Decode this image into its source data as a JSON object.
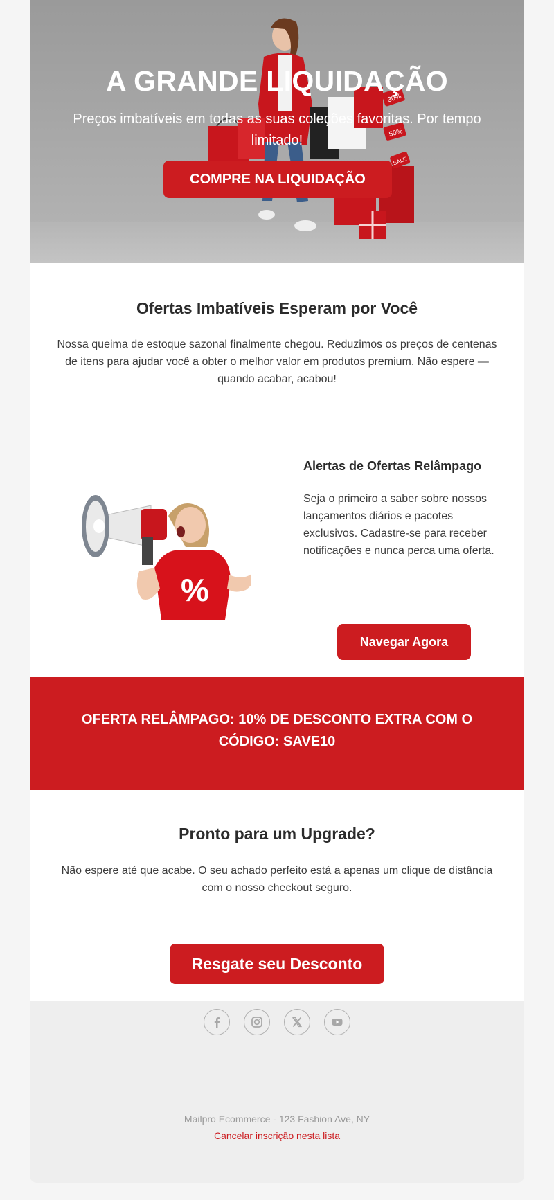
{
  "hero": {
    "title": "A GRANDE LIQUIDAÇÃO",
    "subtitle": "Preços imbatíveis em todas as suas coleções favoritas. Por tempo limitado!",
    "cta_label": "COMPRE NA LIQUIDAÇÃO",
    "tag_labels": [
      "30%",
      "50%",
      "SALE"
    ]
  },
  "intro": {
    "title": "Ofertas Imbatíveis Esperam por Você",
    "text": "Nossa queima de estoque sazonal finalmente chegou. Reduzimos os preços de centenas de itens para ajudar você a obter o melhor valor em produtos premium. Não espere — quando acabar, acabou!"
  },
  "alerts": {
    "title": "Alertas de Ofertas Relâmpago",
    "text": "Seja o primeiro a saber sobre nossos lançamentos diários e pacotes exclusivos. Cadastre-se para receber notificações e nunca perca uma oferta.",
    "cta_label": "Navegar Agora",
    "shirt_symbol": "%"
  },
  "promo": {
    "text": "OFERTA RELÂMPAGO: 10% DE DESCONTO EXTRA COM O CÓDIGO: SAVE10"
  },
  "upgrade": {
    "title": "Pronto para um Upgrade?",
    "text": "Não espere até que acabe. O seu achado perfeito está a apenas um clique de distância com o nosso checkout seguro.",
    "cta_label": "Resgate seu Desconto"
  },
  "footer": {
    "socials": [
      "facebook-icon",
      "instagram-icon",
      "x-icon",
      "youtube-icon"
    ],
    "address": "Mailpro Ecommerce - 123 Fashion Ave, NY",
    "unsubscribe_label": "Cancelar inscrição nesta lista"
  },
  "colors": {
    "accent": "#cc1c20",
    "footer_bg": "#eeeeee",
    "page_bg": "#f5f5f5"
  }
}
